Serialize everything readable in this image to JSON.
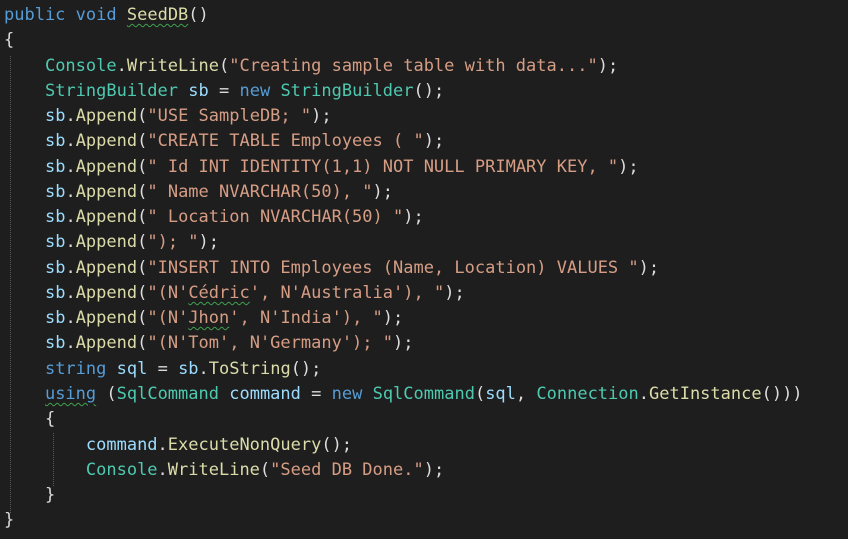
{
  "colors": {
    "background": "#1e1e1e",
    "keyword": "#569cd6",
    "type": "#4ec9b0",
    "string": "#d69d85",
    "variable": "#9cdcfe",
    "method": "#dcdcaa",
    "plain": "#dcdcdc",
    "squiggle": "#3fa14f"
  },
  "code": {
    "l1": {
      "kw1": "public",
      "kw2": "void",
      "name": "SeedDB",
      "rest": "()"
    },
    "l2": {
      "brace": "{"
    },
    "l3": {
      "cls": "Console",
      "dot": ".",
      "method": "WriteLine",
      "open": "(",
      "str": "\"Creating sample table with data...\"",
      "close": ");"
    },
    "l4": {
      "type": "StringBuilder",
      "var": "sb",
      "eq": " = ",
      "kw": "new",
      "type2": "StringBuilder",
      "rest": "();"
    },
    "l5": {
      "var": "sb",
      "dot": ".",
      "method": "Append",
      "open": "(",
      "str": "\"USE SampleDB; \"",
      "close": ");"
    },
    "l6": {
      "var": "sb",
      "dot": ".",
      "method": "Append",
      "open": "(",
      "str": "\"CREATE TABLE Employees ( \"",
      "close": ");"
    },
    "l7": {
      "var": "sb",
      "dot": ".",
      "method": "Append",
      "open": "(",
      "str": "\" Id INT IDENTITY(1,1) NOT NULL PRIMARY KEY, \"",
      "close": ");"
    },
    "l8": {
      "var": "sb",
      "dot": ".",
      "method": "Append",
      "open": "(",
      "str": "\" Name NVARCHAR(50), \"",
      "close": ");"
    },
    "l9": {
      "var": "sb",
      "dot": ".",
      "method": "Append",
      "open": "(",
      "str": "\" Location NVARCHAR(50) \"",
      "close": ");"
    },
    "l10": {
      "var": "sb",
      "dot": ".",
      "method": "Append",
      "open": "(",
      "str": "\"); \"",
      "close": ");"
    },
    "l11": {
      "var": "sb",
      "dot": ".",
      "method": "Append",
      "open": "(",
      "str": "\"INSERT INTO Employees (Name, Location) VALUES \"",
      "close": ");"
    },
    "l12": {
      "var": "sb",
      "dot": ".",
      "method": "Append",
      "open": "(",
      "str_a": "\"(N'",
      "str_sq": "Cédric",
      "str_b": "', N'Australia'), \"",
      "close": ");"
    },
    "l13": {
      "var": "sb",
      "dot": ".",
      "method": "Append",
      "open": "(",
      "str_a": "\"(N'",
      "str_sq": "Jhon",
      "str_b": "', N'India'), \"",
      "close": ");"
    },
    "l14": {
      "var": "sb",
      "dot": ".",
      "method": "Append",
      "open": "(",
      "str": "\"(N'Tom', N'Germany'); \"",
      "close": ");"
    },
    "l15": {
      "kw": "string",
      "var": "sql",
      "eq": " = ",
      "var2": "sb",
      "dot": ".",
      "method": "ToString",
      "rest": "();"
    },
    "l16": {
      "kw": "using",
      "open": " (",
      "type": "SqlCommand",
      "var": "command",
      "eq": " = ",
      "kw2": "new",
      "type2": "SqlCommand",
      "p1": "(",
      "var2": "sql",
      "comma": ", ",
      "cls": "Connection",
      "dot": ".",
      "method": "GetInstance",
      "rest": "()))"
    },
    "l17": {
      "brace": "{"
    },
    "l18": {
      "var": "command",
      "dot": ".",
      "method": "ExecuteNonQuery",
      "rest": "();"
    },
    "l19": {
      "cls": "Console",
      "dot": ".",
      "method": "WriteLine",
      "open": "(",
      "str": "\"Seed DB Done.\"",
      "close": ");"
    },
    "l20": {
      "brace": "}"
    },
    "l21": {
      "brace": "}"
    }
  }
}
